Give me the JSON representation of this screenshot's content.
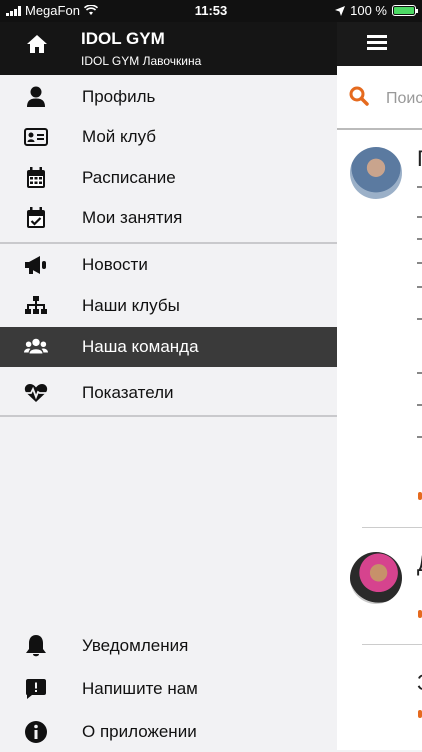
{
  "status": {
    "carrier": "MegaFon",
    "time": "11:53",
    "battery": "100 %"
  },
  "header": {
    "title": "IDOL GYM",
    "subtitle": "IDOL GYM Лавочкина"
  },
  "menu_group1": [
    {
      "label": "Профиль",
      "icon": "person-icon"
    },
    {
      "label": "Мой клуб",
      "icon": "id-card-icon"
    },
    {
      "label": "Расписание",
      "icon": "calendar-icon"
    },
    {
      "label": "Мои занятия",
      "icon": "calendar-check-icon"
    }
  ],
  "menu_group2": [
    {
      "label": "Новости",
      "icon": "megaphone-icon"
    },
    {
      "label": "Наши клубы",
      "icon": "sitemap-icon"
    },
    {
      "label": "Наша команда",
      "icon": "users-icon",
      "active": true
    },
    {
      "label": "Показатели",
      "icon": "heart-pulse-icon"
    }
  ],
  "menu_bottom": [
    {
      "label": "Уведомления",
      "icon": "bell-icon"
    },
    {
      "label": "Напишите нам",
      "icon": "message-icon"
    },
    {
      "label": "О приложении",
      "icon": "info-icon"
    }
  ],
  "background": {
    "search_placeholder": "Поис",
    "letters": [
      "Г",
      "Д",
      "З"
    ],
    "accent": "#e56a1e"
  }
}
